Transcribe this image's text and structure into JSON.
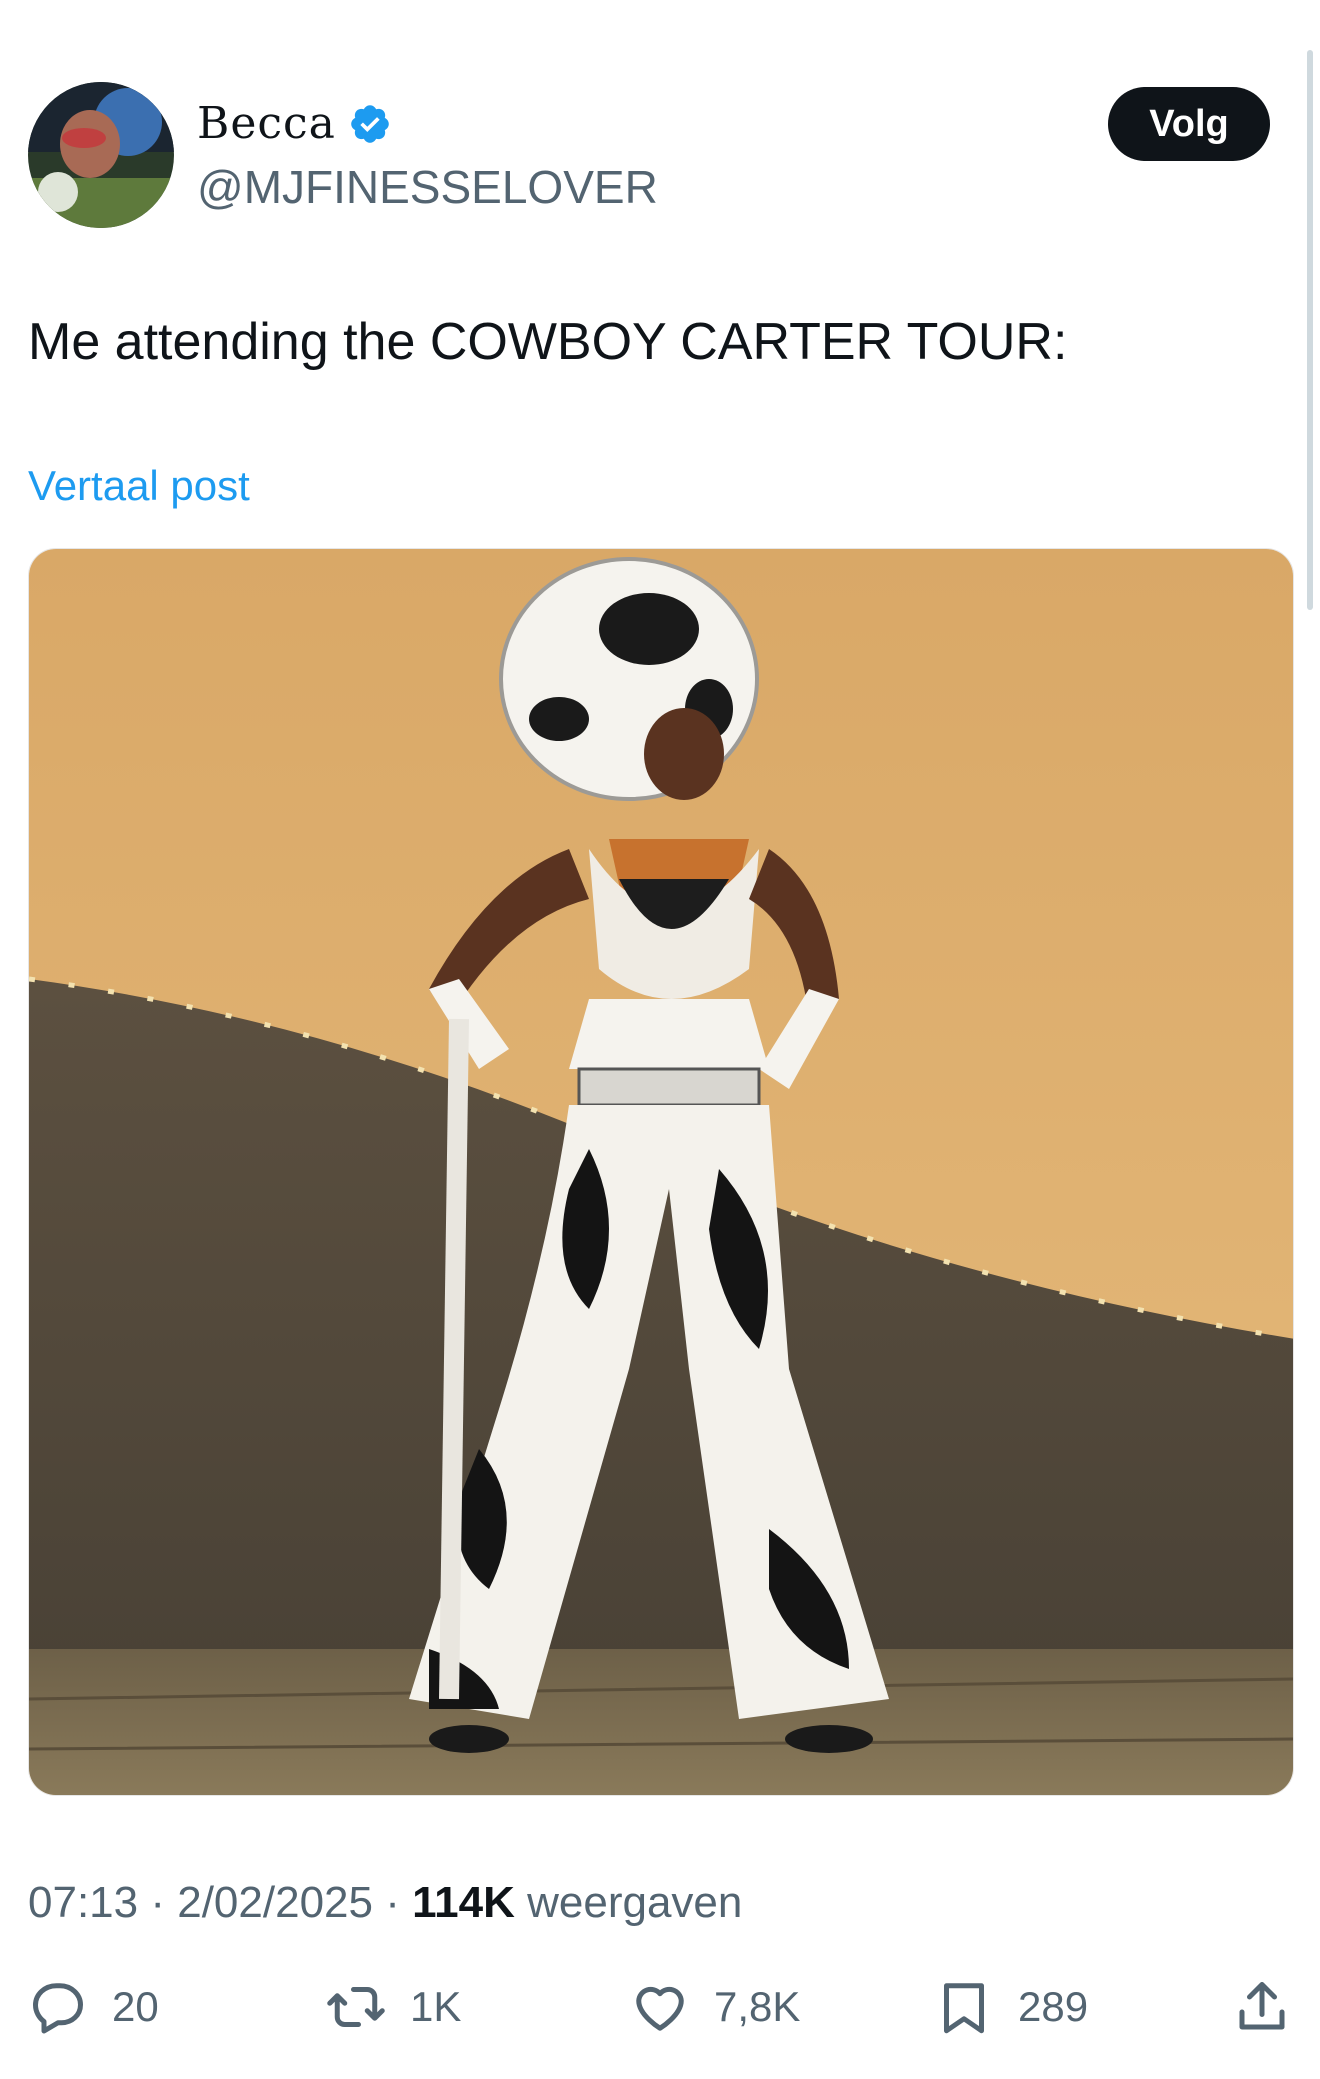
{
  "author": {
    "display_name": "Becca",
    "handle": "@MJFINESSELOVER",
    "verified_icon": "verified-badge-icon",
    "avatar": "avatar"
  },
  "follow_label": "Volg",
  "tweet_text": "Me attending the COWBOY CARTER TOUR:",
  "translate_label": "Vertaal post",
  "meta": {
    "time": "07:13",
    "separator": "·",
    "date": "2/02/2025",
    "views_count": "114K",
    "views_label": "weergaven"
  },
  "actions": {
    "replies": "20",
    "reposts": "1K",
    "likes": "7,8K",
    "bookmarks": "289"
  },
  "icons": [
    "reply-icon",
    "repost-icon",
    "like-icon",
    "bookmark-icon",
    "share-icon",
    "verified-badge-icon"
  ],
  "colors": {
    "text": "#0f1419",
    "secondary": "#536471",
    "link": "#1d9bf0",
    "verified": "#1d9bf0",
    "button_bg": "#0f1419"
  }
}
